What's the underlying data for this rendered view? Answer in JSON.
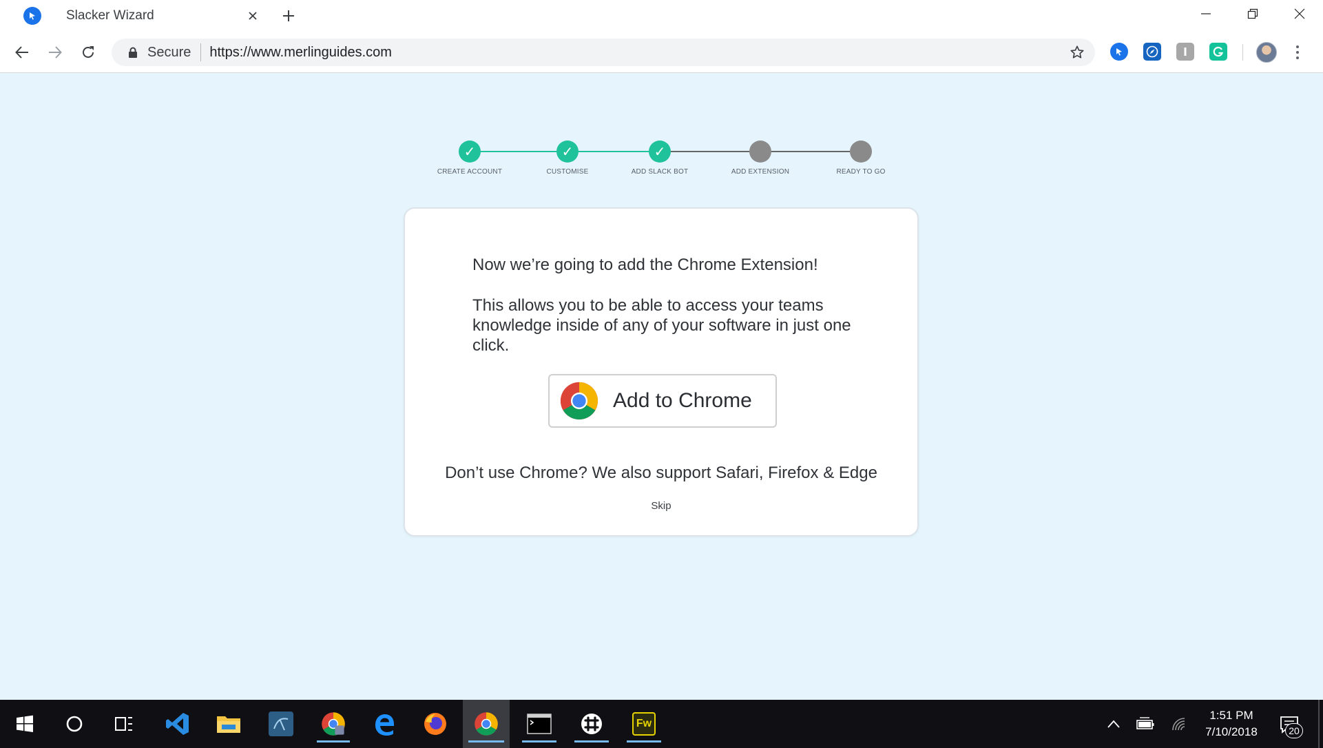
{
  "browser": {
    "tab": {
      "title": "Slacker Wizard",
      "favicon": "merlin-pointer-icon"
    },
    "omnibox": {
      "secure_label": "Secure",
      "url": "https://www.merlinguides.com"
    },
    "extensions": [
      {
        "name": "merlin-extension-icon",
        "color": "#1a73e8"
      },
      {
        "name": "compass-extension-icon",
        "color": "#1565c0"
      },
      {
        "name": "instapaper-extension-icon",
        "color": "#9e9e9e"
      },
      {
        "name": "grammarly-extension-icon",
        "color": "#15c39a"
      }
    ]
  },
  "wizard": {
    "steps": [
      {
        "label": "CREATE ACCOUNT",
        "status": "done",
        "mark": "✓"
      },
      {
        "label": "CUSTOMISE",
        "status": "done",
        "mark": "✓"
      },
      {
        "label": "ADD SLACK BOT",
        "status": "done",
        "mark": "✓"
      },
      {
        "label": "ADD EXTENSION",
        "status": "todo",
        "mark": ""
      },
      {
        "label": "READY TO GO",
        "status": "todo",
        "mark": ""
      }
    ],
    "colors": {
      "done": "#1fc29a",
      "todo": "#8a8a8a",
      "background": "#e6f5fd"
    },
    "card": {
      "heading": "Now we’re going to add the Chrome Extension!",
      "body": "This allows you to be able to access your teams knowledge inside of any of your software in just one click.",
      "add_button_label": "Add to Chrome",
      "support_text": "Don’t use Chrome? We also support Safari, Firefox & Edge",
      "skip_label": "Skip"
    }
  },
  "taskbar": {
    "clock_time": "1:51 PM",
    "clock_date": "7/10/2018",
    "notification_count": "20",
    "fw_label": "Fw",
    "apps": [
      {
        "name": "windows-start-icon"
      },
      {
        "name": "cortana-search-icon"
      },
      {
        "name": "task-view-icon"
      },
      {
        "name": "vscode-icon"
      },
      {
        "name": "file-explorer-icon"
      },
      {
        "name": "mysql-workbench-icon"
      },
      {
        "name": "chrome-profile-icon"
      },
      {
        "name": "edge-icon"
      },
      {
        "name": "firefox-icon"
      },
      {
        "name": "chrome-icon",
        "active": true
      },
      {
        "name": "command-prompt-icon"
      },
      {
        "name": "slack-icon"
      },
      {
        "name": "fireworks-icon"
      }
    ]
  }
}
